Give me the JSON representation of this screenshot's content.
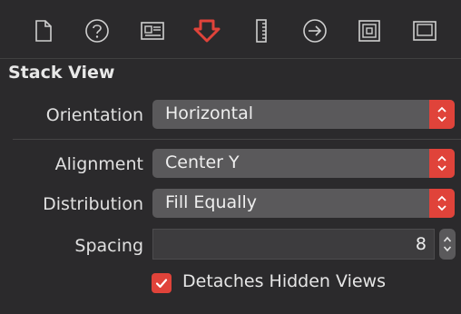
{
  "toolbar": {
    "icons": [
      "file-inspector-icon",
      "quick-help-icon",
      "identity-inspector-icon",
      "attributes-inspector-icon",
      "size-inspector-icon",
      "connections-inspector-icon",
      "bindings-inspector-icon",
      "view-effects-icon"
    ],
    "selected": "attributes-inspector-icon"
  },
  "section": {
    "title": "Stack View"
  },
  "rows": {
    "orientation": {
      "label": "Orientation",
      "value": "Horizontal"
    },
    "alignment": {
      "label": "Alignment",
      "value": "Center Y"
    },
    "distribution": {
      "label": "Distribution",
      "value": "Fill Equally"
    },
    "spacing": {
      "label": "Spacing",
      "value": "8"
    }
  },
  "detaches": {
    "label": "Detaches Hidden Views",
    "checked": true
  },
  "colors": {
    "accent": "#e0433a",
    "background": "#2b2a2c",
    "popup": "#5a595b",
    "icon": "#cfcfcf"
  }
}
